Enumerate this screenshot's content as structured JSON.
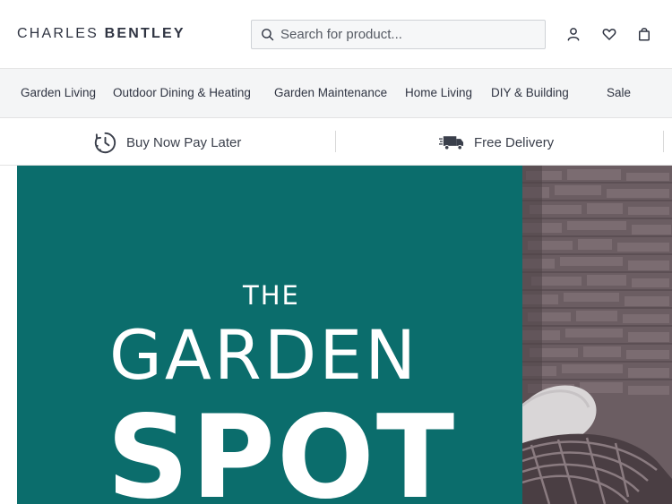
{
  "brand": {
    "name_light": "CHARLES",
    "name_bold": "BENTLEY"
  },
  "search": {
    "placeholder": "Search for product..."
  },
  "header_icons": [
    "account-icon",
    "wishlist-heart-icon",
    "basket-bag-icon"
  ],
  "nav": {
    "items": [
      {
        "label": "Garden Living"
      },
      {
        "label": "Outdoor Dining & Heating"
      },
      {
        "label": "Garden Maintenance"
      },
      {
        "label": "Home Living"
      },
      {
        "label": "DIY & Building"
      },
      {
        "label": "Sale"
      }
    ]
  },
  "usp": {
    "items": [
      {
        "label": "Buy Now Pay Later",
        "icon": "clock-icon"
      },
      {
        "label": "Free Delivery",
        "icon": "delivery-truck-icon"
      }
    ]
  },
  "hero": {
    "line1": "THE",
    "line2": "GARDEN",
    "line3": "SPOT"
  },
  "colors": {
    "hero_bg": "#0b6d6c",
    "text_dark": "#2f3442",
    "nav_bg": "#f4f5f6"
  }
}
